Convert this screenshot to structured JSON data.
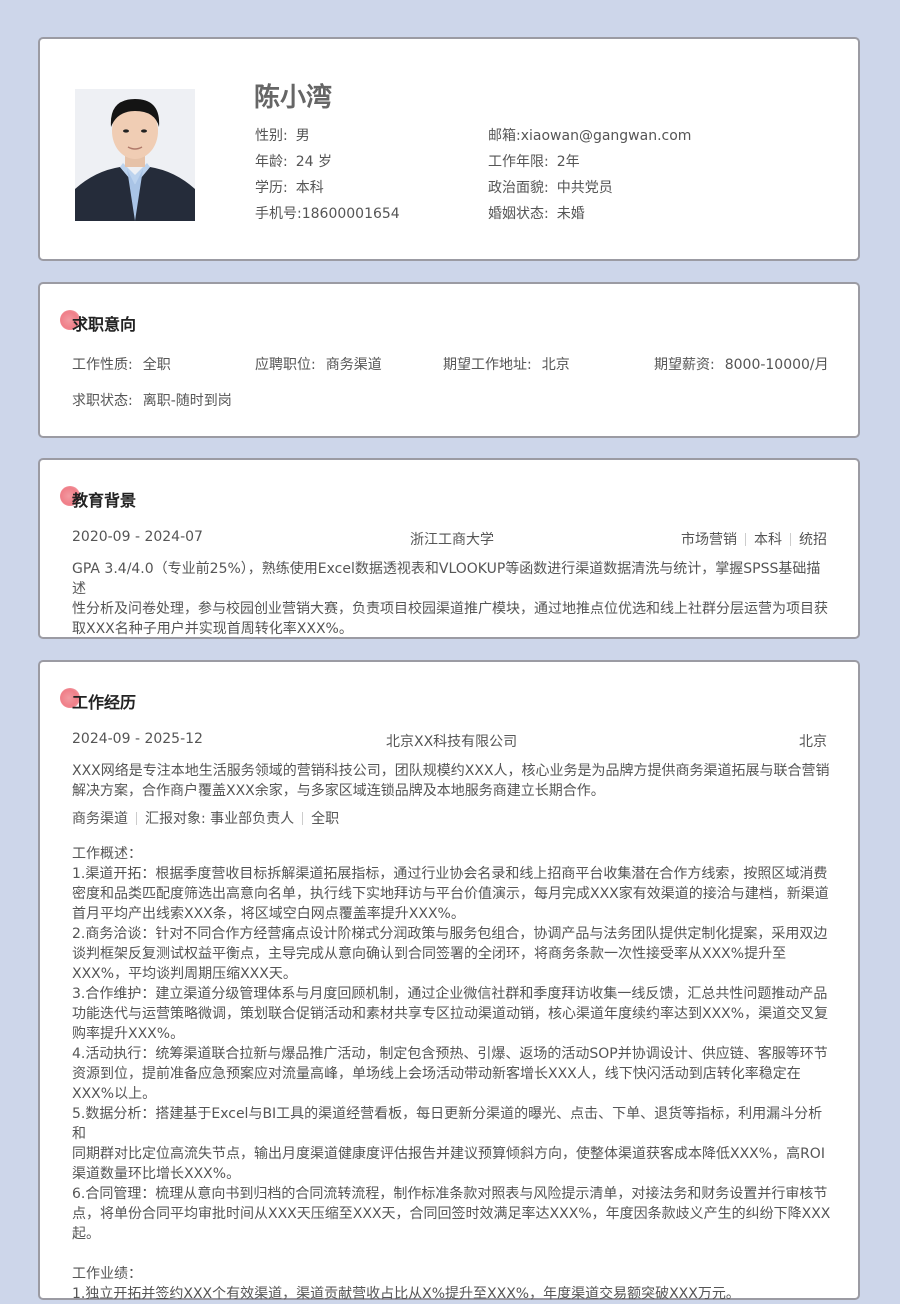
{
  "profile": {
    "name": "陈小湾",
    "gender": {
      "label": "性别:",
      "value": "男"
    },
    "age": {
      "label": "年龄:",
      "value": "24 岁"
    },
    "education": {
      "label": "学历:",
      "value": "本科"
    },
    "phone": {
      "label": "手机号:",
      "value": "18600001654"
    },
    "email": {
      "label": "邮箱:",
      "value": "xiaowan@gangwan.com"
    },
    "years": {
      "label": "工作年限:",
      "value": "2年"
    },
    "political": {
      "label": "政治面貌:",
      "value": "中共党员"
    },
    "marital": {
      "label": "婚姻状态:",
      "value": "未婚"
    }
  },
  "intent": {
    "title": "求职意向",
    "nature": {
      "label": "工作性质:",
      "value": "全职"
    },
    "position": {
      "label": "应聘职位:",
      "value": "商务渠道"
    },
    "location": {
      "label": "期望工作地址:",
      "value": "北京"
    },
    "salary": {
      "label": "期望薪资:",
      "value": "8000-10000/月"
    },
    "status": {
      "label": "求职状态:",
      "value": "离职-随时到岗"
    }
  },
  "education": {
    "title": "教育背景",
    "period": "2020-09 - 2024-07",
    "school": "浙江工商大学",
    "major": "市场营销",
    "degree": "本科",
    "mode": "统招",
    "lines": [
      "GPA 3.4/4.0（专业前25%），熟练使用Excel数据透视表和VLOOKUP等函数进行渠道数据清洗与统计，掌握SPSS基础描述",
      "性分析及问卷处理，参与校园创业营销大赛，负责项目校园渠道推广模块，通过地推点位优选和线上社群分层运营为项目获",
      "取XXX名种子用户并实现首周转化率XXX%。"
    ]
  },
  "work": {
    "title": "工作经历",
    "period": "2024-09 - 2025-12",
    "company": "北京XX科技有限公司",
    "city": "北京",
    "intro": [
      "XXX网络是专注本地生活服务领域的营销科技公司，团队规模约XXX人，核心业务是为品牌方提供商务渠道拓展与联合营销",
      "解决方案，合作商户覆盖XXX余家，与多家区域连锁品牌及本地服务商建立长期合作。"
    ],
    "tag_role": "商务渠道",
    "tag_report": "汇报对象: 事业部负责人",
    "tag_type": "全职",
    "overview_title": "工作概述：",
    "details": [
      "1.渠道开拓：根据季度营收目标拆解渠道拓展指标，通过行业协会名录和线上招商平台收集潜在合作方线索，按照区域消费",
      "密度和品类匹配度筛选出高意向名单，执行线下实地拜访与平台价值演示，每月完成XXX家有效渠道的接洽与建档，新渠道",
      "首月平均产出线索XXX条，将区域空白网点覆盖率提升XXX%。",
      "2.商务洽谈：针对不同合作方经营痛点设计阶梯式分润政策与服务包组合，协调产品与法务团队提供定制化提案，采用双边",
      "谈判框架反复测试权益平衡点，主导完成从意向确认到合同签署的全闭环，将商务条款一次性接受率从XXX%提升至",
      "XXX%，平均谈判周期压缩XXX天。",
      "3.合作维护：建立渠道分级管理体系与月度回顾机制，通过企业微信社群和季度拜访收集一线反馈，汇总共性问题推动产品",
      "功能迭代与运营策略微调，策划联合促销活动和素材共享专区拉动渠道动销，核心渠道年度续约率达到XXX%，渠道交叉复",
      "购率提升XXX%。",
      "4.活动执行：统筹渠道联合拉新与爆品推广活动，制定包含预热、引爆、返场的活动SOP并协调设计、供应链、客服等环节",
      "资源到位，提前准备应急预案应对流量高峰，单场线上会场活动带动新客增长XXX人，线下快闪活动到店转化率稳定在",
      "XXX%以上。",
      "5.数据分析：搭建基于Excel与BI工具的渠道经营看板，每日更新分渠道的曝光、点击、下单、退货等指标，利用漏斗分析和",
      "同期群对比定位高流失节点，输出月度渠道健康度评估报告并建议预算倾斜方向，使整体渠道获客成本降低XXX%，高ROI",
      "渠道数量环比增长XXX%。",
      "6.合同管理：梳理从意向书到归档的合同流转流程，制作标准条款对照表与风险提示清单，对接法务和财务设置并行审核节",
      "点，将单份合同平均审批时间从XXX天压缩至XXX天，合同回签时效满足率达XXX%，年度因条款歧义产生的纠纷下降XXX",
      "起。"
    ],
    "achievement_title": "工作业绩：",
    "achievements": [
      "1.独立开拓并签约XXX个有效渠道，渠道贡献营收占比从X%提升至XXX%，年度渠道交易额突破XXX万元。"
    ]
  }
}
